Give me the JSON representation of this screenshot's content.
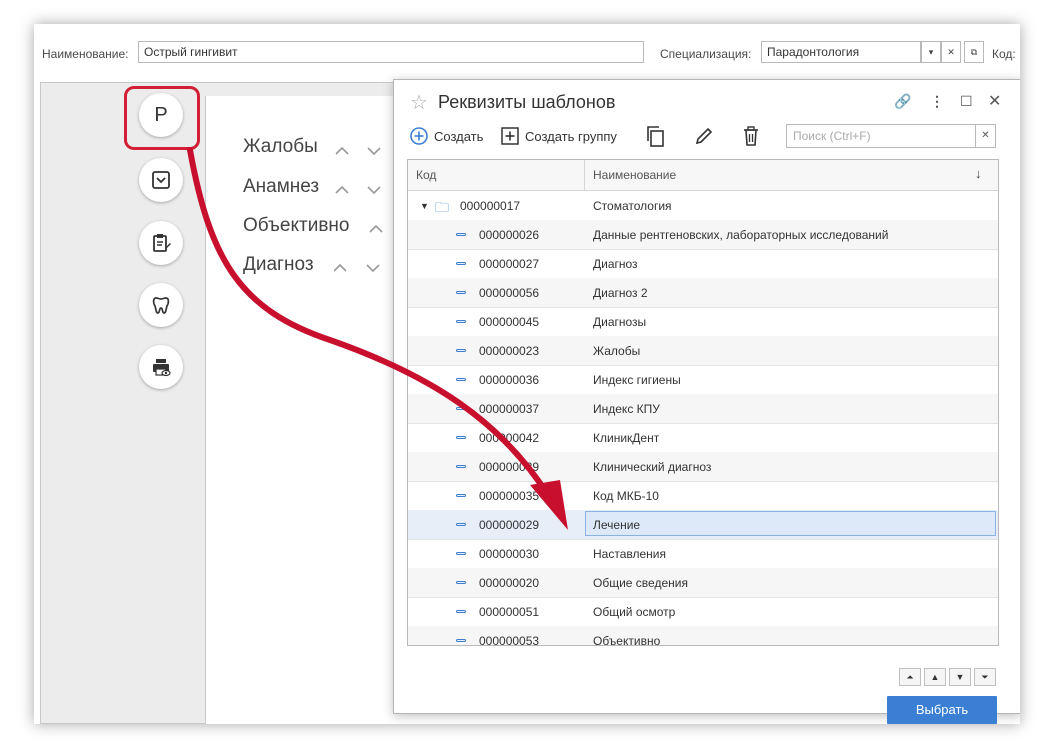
{
  "form": {
    "name_label": "Наименование:",
    "name_value": "Острый гингивит",
    "spec_label": "Специализация:",
    "spec_value": "Парадонтология",
    "code_label": "Код:"
  },
  "side_buttons": {
    "p_label": "Р"
  },
  "sections": [
    {
      "label": "Жалобы"
    },
    {
      "label": "Анамнез"
    },
    {
      "label": "Объективно"
    },
    {
      "label": "Диагноз"
    }
  ],
  "dialog": {
    "title": "Реквизиты шаблонов",
    "create_label": "Создать",
    "create_group_label": "Создать группу",
    "search_placeholder": "Поиск (Ctrl+F)",
    "col_code": "Код",
    "col_name": "Наименование",
    "select_label": "Выбрать",
    "rows": [
      {
        "code": "000000017",
        "name": "Стоматология",
        "group": true
      },
      {
        "code": "000000026",
        "name": "Данные рентгеновских, лабораторных исследований"
      },
      {
        "code": "000000027",
        "name": "Диагноз"
      },
      {
        "code": "000000056",
        "name": "Диагноз 2"
      },
      {
        "code": "000000045",
        "name": "Диагнозы"
      },
      {
        "code": "000000023",
        "name": "Жалобы"
      },
      {
        "code": "000000036",
        "name": "Индекс гигиены"
      },
      {
        "code": "000000037",
        "name": "Индекс КПУ"
      },
      {
        "code": "000000042",
        "name": "КлиникДент"
      },
      {
        "code": "000000039",
        "name": "Клинический диагноз"
      },
      {
        "code": "000000035",
        "name": "Код МКБ-10"
      },
      {
        "code": "000000029",
        "name": "Лечение",
        "selected": true
      },
      {
        "code": "000000030",
        "name": "Наставления"
      },
      {
        "code": "000000020",
        "name": "Общие сведения"
      },
      {
        "code": "000000051",
        "name": "Общий осмотр"
      },
      {
        "code": "000000053",
        "name": "Объективно"
      }
    ]
  },
  "colors": {
    "accent": "#3a7fd4",
    "highlight": "#d21f35"
  }
}
